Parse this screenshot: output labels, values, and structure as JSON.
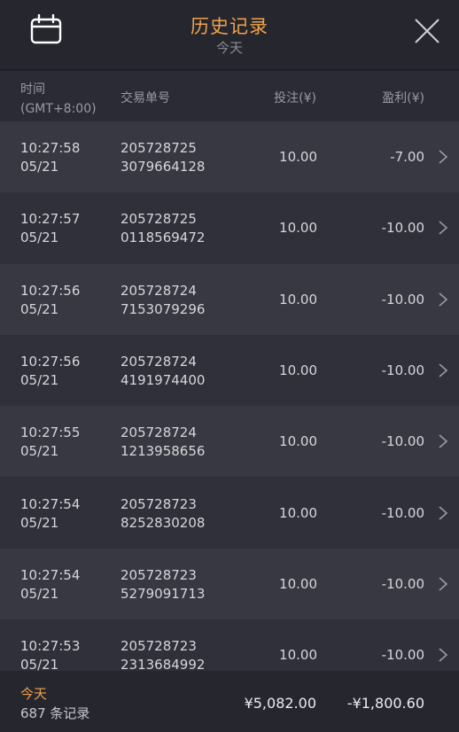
{
  "header": {
    "title": "历史记录",
    "subtitle": "今天",
    "calendar_icon": "calendar-icon",
    "close_icon": "close-icon"
  },
  "columns": {
    "time": "时间",
    "timezone": "(GMT+8:00)",
    "id": "交易单号",
    "bet": "投注(¥)",
    "profit": "盈利(¥)"
  },
  "rows": [
    {
      "time": "10:27:58",
      "date": "05/21",
      "id1": "205728725",
      "id2": "3079664128",
      "bet": "10.00",
      "profit": "-7.00"
    },
    {
      "time": "10:27:57",
      "date": "05/21",
      "id1": "205728725",
      "id2": "0118569472",
      "bet": "10.00",
      "profit": "-10.00"
    },
    {
      "time": "10:27:56",
      "date": "05/21",
      "id1": "205728724",
      "id2": "7153079296",
      "bet": "10.00",
      "profit": "-10.00"
    },
    {
      "time": "10:27:56",
      "date": "05/21",
      "id1": "205728724",
      "id2": "4191974400",
      "bet": "10.00",
      "profit": "-10.00"
    },
    {
      "time": "10:27:55",
      "date": "05/21",
      "id1": "205728724",
      "id2": "1213958656",
      "bet": "10.00",
      "profit": "-10.00"
    },
    {
      "time": "10:27:54",
      "date": "05/21",
      "id1": "205728723",
      "id2": "8252830208",
      "bet": "10.00",
      "profit": "-10.00"
    },
    {
      "time": "10:27:54",
      "date": "05/21",
      "id1": "205728723",
      "id2": "5279091713",
      "bet": "10.00",
      "profit": "-10.00"
    },
    {
      "time": "10:27:53",
      "date": "05/21",
      "id1": "205728723",
      "id2": "2313684992",
      "bet": "10.00",
      "profit": "-10.00"
    }
  ],
  "footer": {
    "label": "今天",
    "count": "687 条记录",
    "total_bet": "¥5,082.00",
    "total_profit": "-¥1,800.60"
  },
  "colors": {
    "accent": "#f0a24a",
    "background": "#2b2b35",
    "row_odd": "#383842",
    "row_even": "#30303a"
  }
}
